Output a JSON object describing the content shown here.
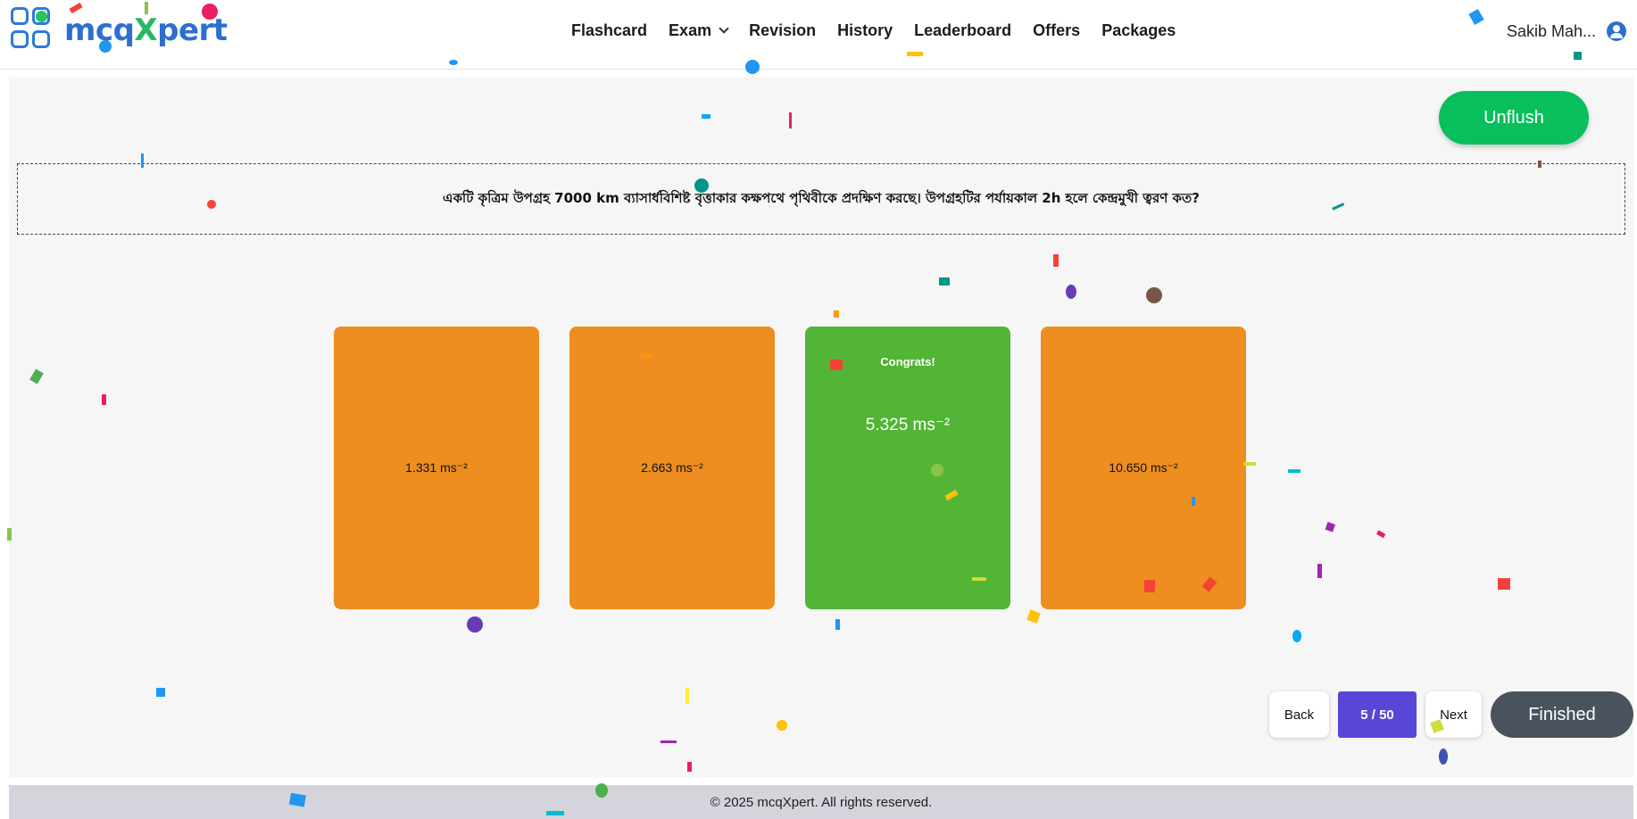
{
  "header": {
    "logo": {
      "text_main": "mcq",
      "text_x": "X",
      "text_end": "pert"
    },
    "nav": [
      {
        "label": "Flashcard"
      },
      {
        "label": "Exam",
        "has_dropdown": true
      },
      {
        "label": "Revision"
      },
      {
        "label": "History"
      },
      {
        "label": "Leaderboard"
      },
      {
        "label": "Offers"
      },
      {
        "label": "Packages"
      }
    ],
    "user": {
      "name": "Sakib Mah...",
      "icon": "user-circle-icon"
    }
  },
  "toolbar": {
    "unflush_label": "Unflush"
  },
  "question": {
    "text": "একটি কৃত্রিম উপগ্রহ 7000 km ব্যাসার্ধবিশিষ্ট বৃত্তাকার কক্ষপথে পৃথিবীকে প্রদক্ষিণ করছে। উপগ্রহটির পর্যায়কাল 2h হলে কেন্দ্রমুখী ত্বরণ কত?"
  },
  "options": [
    {
      "value": "1.331 ms⁻²",
      "state": "revealed"
    },
    {
      "value": "2.663 ms⁻²",
      "state": "revealed"
    },
    {
      "value": "5.325 ms⁻²",
      "state": "correct",
      "message": "Congrats!"
    },
    {
      "value": "10.650 ms⁻²",
      "state": "revealed"
    }
  ],
  "pagination": {
    "back_label": "Back",
    "page_indicator": "5 / 50",
    "next_label": "Next",
    "finished_label": "Finished"
  },
  "footer": {
    "text": "© 2025 mcqXpert. All rights reserved."
  },
  "colors": {
    "card_orange": "#ee8d20",
    "card_green": "#52b535",
    "unflush_green": "#07c05c",
    "page_purple": "#5847d6",
    "finished_gray": "#4a535d",
    "brand_blue": "#2d6fd0"
  }
}
